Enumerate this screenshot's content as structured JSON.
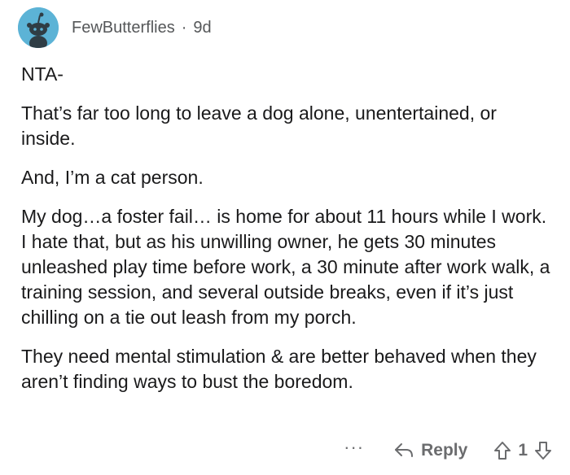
{
  "comment": {
    "author": "FewButterflies",
    "separator": "·",
    "age": "9d",
    "paragraphs": [
      "NTA-",
      "That’s far too long to leave a dog alone, unentertained, or inside.",
      "And, I’m a cat person.",
      "My dog…a foster fail… is home for about 11 hours while I work.  I hate that, but as his unwilling owner, he gets 30 minutes unleashed play time before work, a 30 minute after work walk, a training session, and several outside breaks, even if it’s just chilling on a tie out leash from my porch.",
      "They need mental stimulation & are better behaved when they aren’t finding ways to bust the boredom."
    ],
    "actions": {
      "more_label": "···",
      "reply_label": "Reply",
      "vote_count": "1"
    }
  },
  "colors": {
    "avatar_bg": "#5cb3d6",
    "meta_text": "#555759",
    "action_text": "#6b6c6e"
  },
  "icons": {
    "avatar": "snoo-avatar-icon",
    "reply": "reply-arrow-icon",
    "upvote": "upvote-arrow-icon",
    "downvote": "downvote-arrow-icon"
  }
}
